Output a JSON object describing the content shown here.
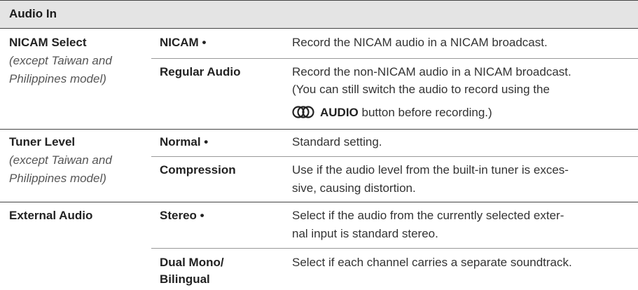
{
  "header": {
    "title": "Audio In"
  },
  "rows": {
    "nicam": {
      "name": "NICAM Select",
      "note": "(except Taiwan and Philippines model)",
      "opt1": "NICAM •",
      "desc1": "Record the NICAM audio in a NICAM broadcast.",
      "opt2": "Regular Audio",
      "desc2_l1": "Record the non-NICAM audio in a NICAM broadcast.",
      "desc2_l2": "(You can still switch the audio to record using the",
      "desc2_button": "AUDIO",
      "desc2_l3": "button before recording.)"
    },
    "tuner": {
      "name": "Tuner Level",
      "note": "(except Taiwan and Philippines model)",
      "opt1": "Normal •",
      "desc1": "Standard setting.",
      "opt2": "Compression",
      "desc2_l1": "Use if the audio level from the built-in tuner is exces-",
      "desc2_l2": "sive, causing distortion."
    },
    "external": {
      "name": "External Audio",
      "opt1": "Stereo •",
      "desc1_l1": "Select if the audio from the currently selected exter-",
      "desc1_l2": "nal input is standard stereo.",
      "opt2_l1": "Dual Mono/",
      "opt2_l2": "Bilingual",
      "desc2": "Select if each channel carries a separate soundtrack."
    }
  },
  "icons": {
    "audio_button": "audio-button-icon"
  }
}
